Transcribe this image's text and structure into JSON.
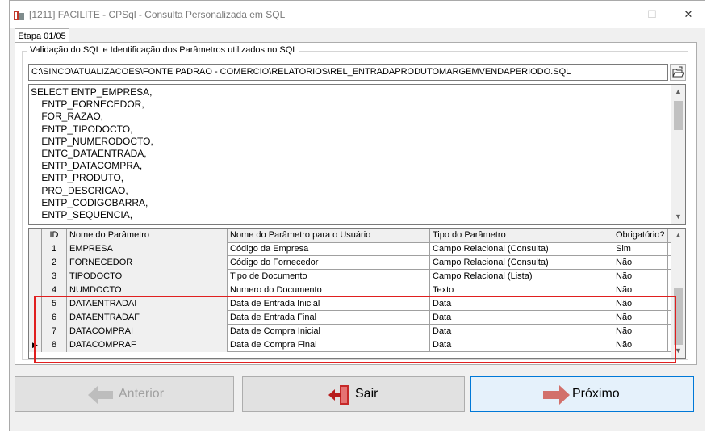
{
  "window": {
    "title": "[1211] FACILITE - CPSql - Consulta Personalizada em SQL",
    "minimize_glyph": "—",
    "maximize_glyph": "☐",
    "close_glyph": "✕"
  },
  "tabs": [
    {
      "label": "Etapa 01/05",
      "selected": true
    }
  ],
  "group": {
    "label": "Validação do SQL e Identificação dos Parâmetros utilizados no SQL",
    "file_path": "C:\\SINCO\\ATUALIZACOES\\FONTE PADRAO - COMERCIO\\RELATORIOS\\REL_ENTRADAPRODUTOMARGEMVENDAPERIODO.SQL"
  },
  "sql_lines": [
    "SELECT ENTP_EMPRESA,",
    "    ENTP_FORNECEDOR,",
    "    FOR_RAZAO,",
    "    ENTP_TIPODOCTO,",
    "    ENTP_NUMERODOCTO,",
    "    ENTC_DATAENTRADA,",
    "    ENTP_DATACOMPRA,",
    "    ENTP_PRODUTO,",
    "    PRO_DESCRICAO,",
    "    ENTP_CODIGOBARRA,",
    "    ENTP_SEQUENCIA,"
  ],
  "grid": {
    "columns": [
      "ID",
      "Nome do Parâmetro",
      "Nome do Parâmetro para o Usuário",
      "Tipo do Parâmetro",
      "Obrigatório?"
    ],
    "rows": [
      {
        "id": "1",
        "name": "EMPRESA",
        "user_name": "Código da Empresa",
        "type": "Campo Relacional (Consulta)",
        "required": "Sim"
      },
      {
        "id": "2",
        "name": "FORNECEDOR",
        "user_name": "Código do Fornecedor",
        "type": "Campo Relacional (Consulta)",
        "required": "Não"
      },
      {
        "id": "3",
        "name": "TIPODOCTO",
        "user_name": "Tipo de Documento",
        "type": "Campo Relacional (Lista)",
        "required": "Não"
      },
      {
        "id": "4",
        "name": "NUMDOCTO",
        "user_name": "Numero do Documento",
        "type": "Texto",
        "required": "Não"
      },
      {
        "id": "5",
        "name": "DATAENTRADAI",
        "user_name": "Data de Entrada Inicial",
        "type": "Data",
        "required": "Não"
      },
      {
        "id": "6",
        "name": "DATAENTRADAF",
        "user_name": "Data de Entrada Final",
        "type": "Data",
        "required": "Não"
      },
      {
        "id": "7",
        "name": "DATACOMPRAI",
        "user_name": "Data de Compra Inicial",
        "type": "Data",
        "required": "Não"
      },
      {
        "id": "8",
        "name": "DATACOMPRAF",
        "user_name": "Data de Compra Final",
        "type": "Data",
        "required": "Não"
      }
    ],
    "current_row_marker": "▶"
  },
  "buttons": {
    "previous": "Anterior",
    "exit": "Sair",
    "next": "Próximo"
  },
  "colors": {
    "highlight": "#e01f1f",
    "next_button_border": "#0078d7"
  }
}
